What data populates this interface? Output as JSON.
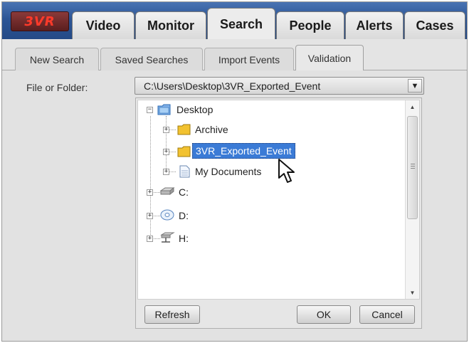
{
  "logo": {
    "text": "3VR"
  },
  "main_tabs": [
    {
      "label": "Video",
      "active": false
    },
    {
      "label": "Monitor",
      "active": false
    },
    {
      "label": "Search",
      "active": true
    },
    {
      "label": "People",
      "active": false
    },
    {
      "label": "Alerts",
      "active": false
    },
    {
      "label": "Cases",
      "active": false
    }
  ],
  "sub_tabs": [
    {
      "label": "New Search",
      "active": false
    },
    {
      "label": "Saved Searches",
      "active": false
    },
    {
      "label": "Import Events",
      "active": false
    },
    {
      "label": "Validation",
      "active": true
    }
  ],
  "file_field": {
    "label": "File or Folder:",
    "value": "C:\\Users\\Desktop\\3VR_Exported_Event"
  },
  "tree": {
    "nodes": [
      {
        "label": "Desktop",
        "icon": "desktop-icon",
        "expanded": true
      },
      {
        "label": "Archive",
        "icon": "folder-icon"
      },
      {
        "label": "3VR_Exported_Event",
        "icon": "folder-icon",
        "selected": true
      },
      {
        "label": "My Documents",
        "icon": "document-icon"
      },
      {
        "label": "C:",
        "icon": "hard-drive-icon"
      },
      {
        "label": "D:",
        "icon": "cd-drive-icon"
      },
      {
        "label": "H:",
        "icon": "network-drive-icon"
      }
    ]
  },
  "buttons": {
    "refresh": "Refresh",
    "ok": "OK",
    "cancel": "Cancel"
  },
  "colors": {
    "topbar": "#2c5596",
    "selection": "#3b7bd6",
    "folder": "#f2c230"
  }
}
